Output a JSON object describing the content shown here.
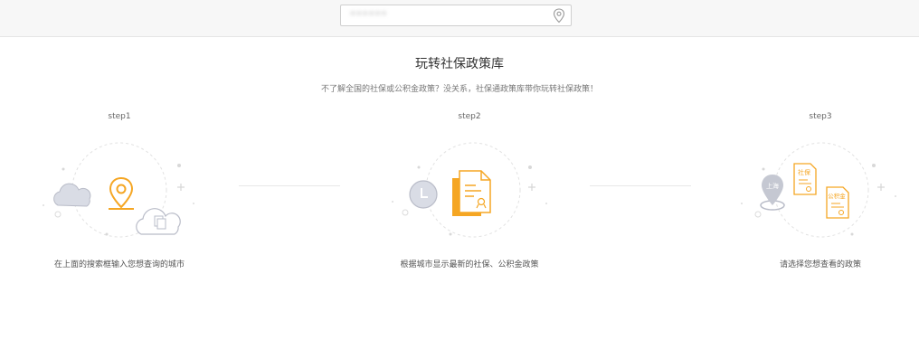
{
  "search": {
    "value": "••••••",
    "icon": "location-pin-icon"
  },
  "heading": {
    "title": "玩转社保政策库",
    "subtitle": "不了解全国的社保或公积金政策？没关系，社保通政策库带你玩转社保政策！"
  },
  "steps": [
    {
      "label": "step1",
      "desc": "在上面的搜索框输入您想查询的城市"
    },
    {
      "label": "step2",
      "desc": "根据城市显示最新的社保、公积金政策"
    },
    {
      "label": "step3",
      "desc": "请选择您想查看的政策",
      "pin_text": "上海",
      "doc1_text": "社保",
      "doc2_text": "公积金"
    }
  ],
  "colors": {
    "accent": "#f5a623",
    "grey": "#b9bcc8",
    "bg_top": "#f7f7f7"
  }
}
